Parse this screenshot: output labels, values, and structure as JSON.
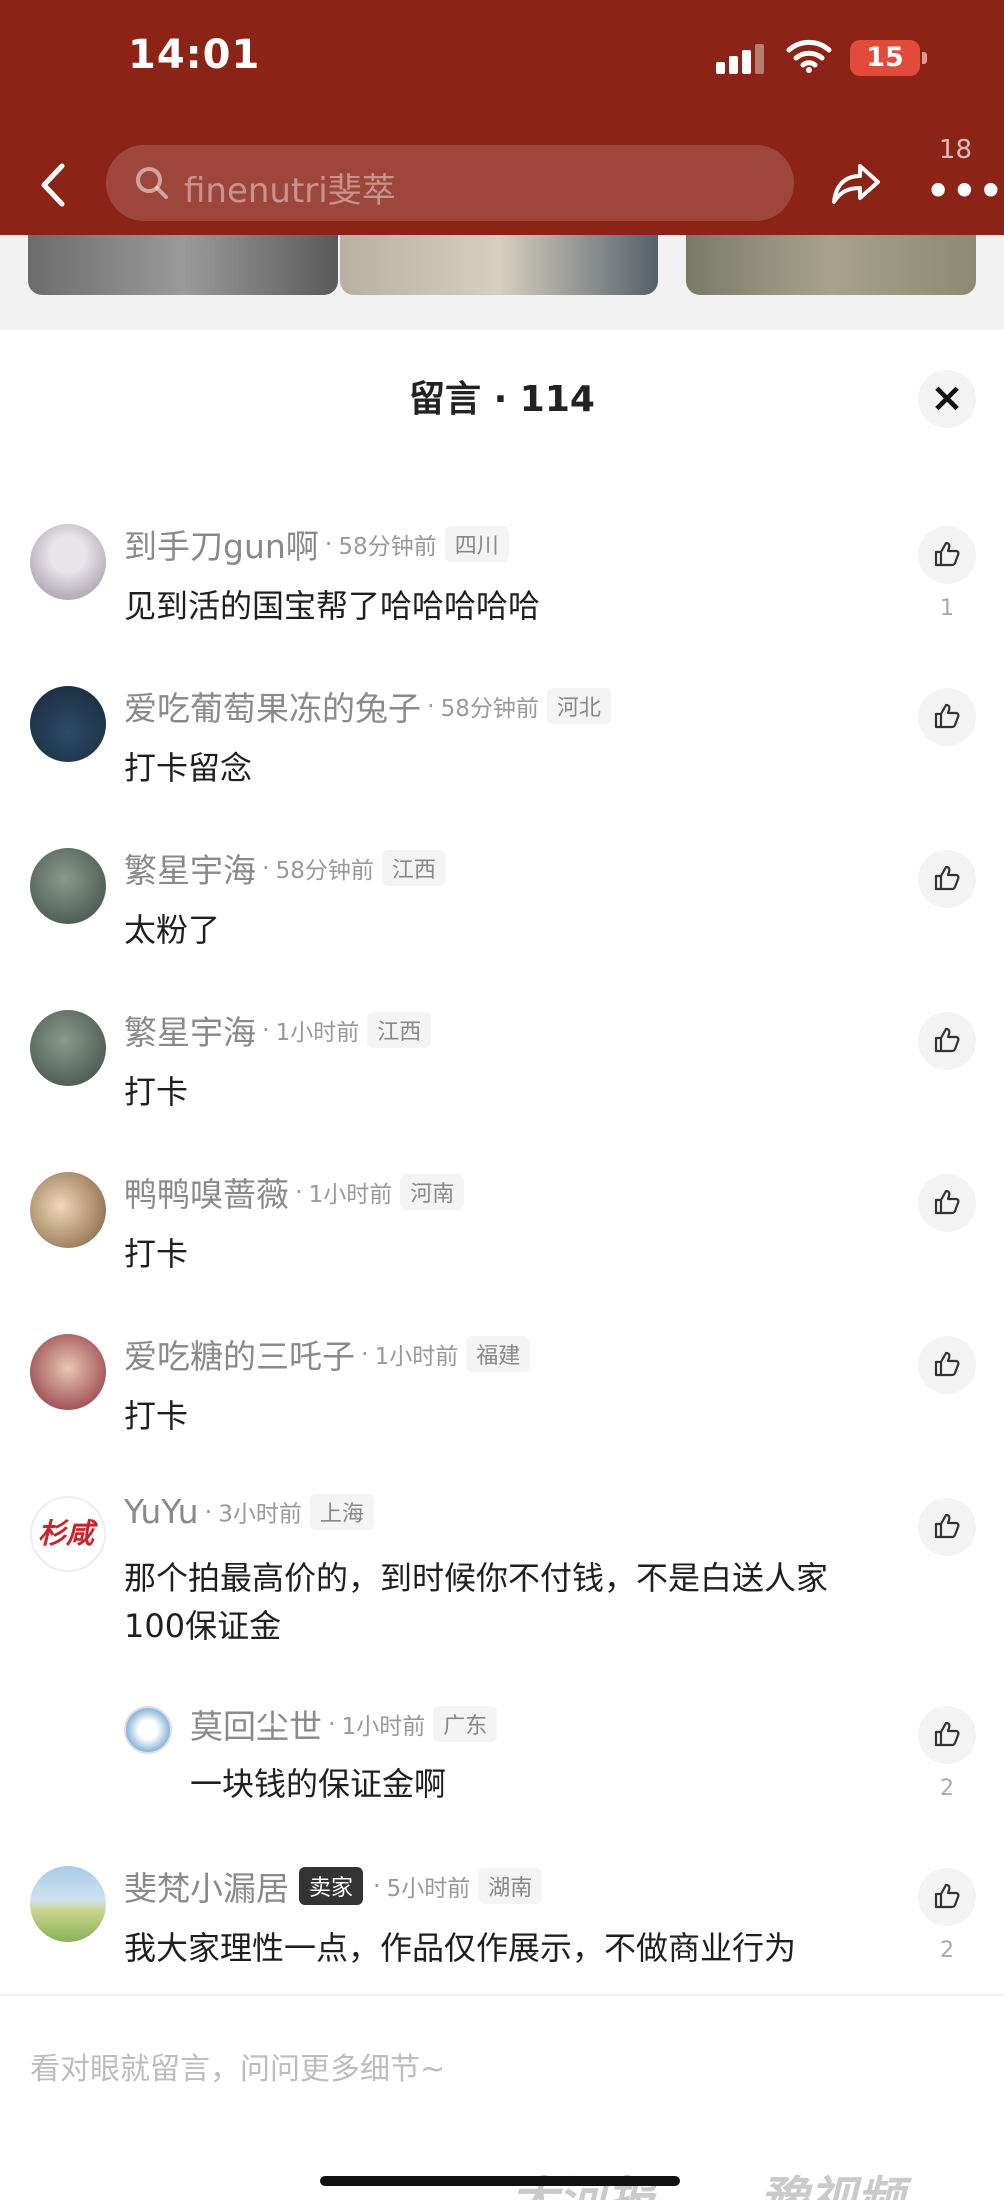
{
  "status": {
    "time": "14:01",
    "battery": "15"
  },
  "header": {
    "search_text": "finenutri斐萃",
    "more_count": "18"
  },
  "sheet": {
    "title": "留言 · 114"
  },
  "comments": [
    {
      "name": "到手刀gun啊",
      "time": "58分钟前",
      "loc": "四川",
      "text": "见到活的国宝帮了哈哈哈哈哈",
      "likes": "1"
    },
    {
      "name": "爱吃葡萄果冻的兔子",
      "time": "58分钟前",
      "loc": "河北",
      "text": "打卡留念",
      "likes": ""
    },
    {
      "name": "繁星宇海",
      "time": "58分钟前",
      "loc": "江西",
      "text": "太粉了",
      "likes": ""
    },
    {
      "name": "繁星宇海",
      "time": "1小时前",
      "loc": "江西",
      "text": "打卡",
      "likes": ""
    },
    {
      "name": "鸭鸭嗅蔷薇",
      "time": "1小时前",
      "loc": "河南",
      "text": "打卡",
      "likes": ""
    },
    {
      "name": "爱吃糖的三吒子",
      "time": "1小时前",
      "loc": "福建",
      "text": "打卡",
      "likes": ""
    },
    {
      "name": "YuYu",
      "time": "3小时前",
      "loc": "上海",
      "text": "那个拍最高价的，到时候你不付钱，不是白送人家100保证金",
      "likes": ""
    },
    {
      "name": "莫回尘世",
      "time": "1小时前",
      "loc": "广东",
      "text": "一块钱的保证金啊",
      "likes": "2"
    },
    {
      "name": "斐梵小漏居",
      "badge": "卖家",
      "time": "5小时前",
      "loc": "湖南",
      "text": "我大家理性一点，作品仅作展示，不做商业行为",
      "likes": "2"
    }
  ],
  "input": {
    "placeholder": "看对眼就留言，问问更多细节~"
  },
  "watermark": {
    "left": "大河报",
    "right": "豫视频"
  },
  "colors": {
    "header_bg": "#8c2317",
    "battery": "#e04b3c"
  }
}
